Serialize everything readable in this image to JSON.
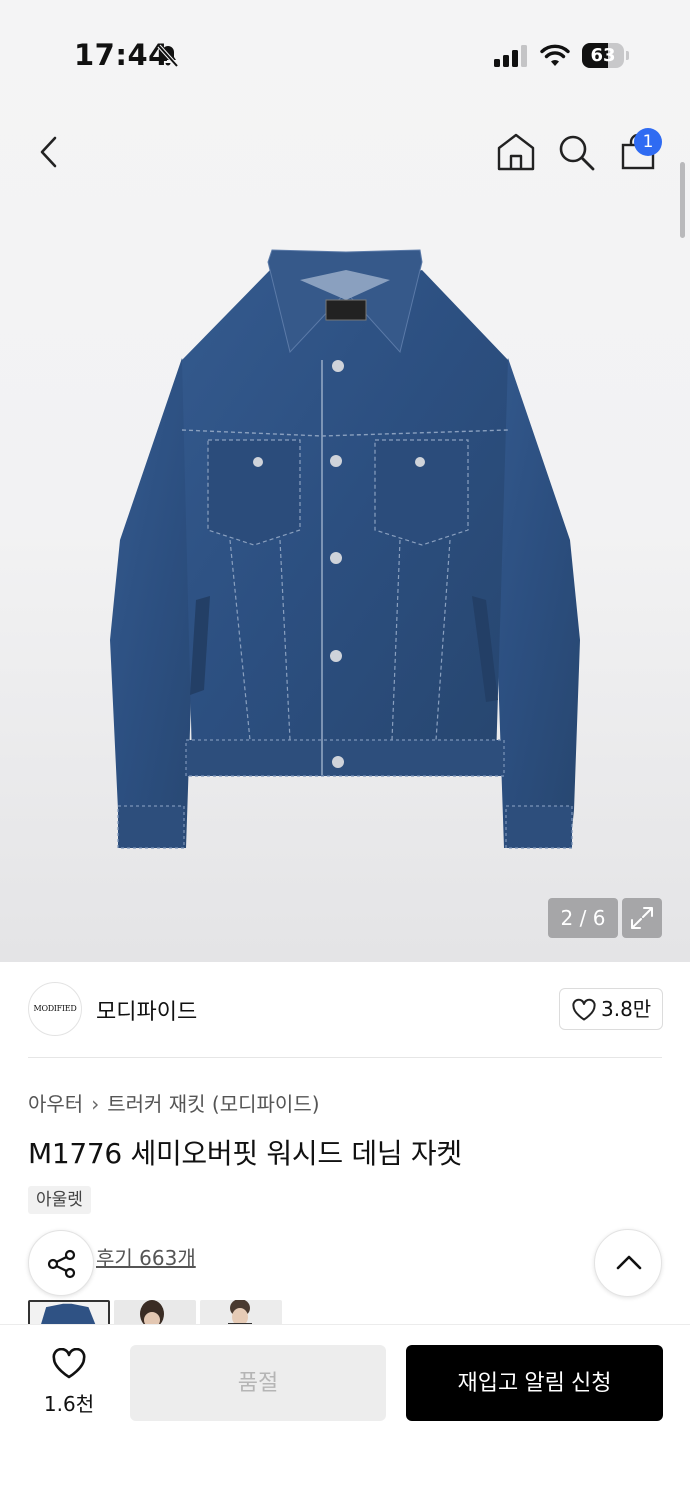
{
  "status_bar": {
    "time": "17:44",
    "battery": "63",
    "battery_level": 0.63,
    "icons": [
      "bell-slash-icon",
      "cellular-signal-icon",
      "wifi-icon",
      "battery-icon"
    ]
  },
  "nav": {
    "cart_badge": "1",
    "icons": [
      "back-chevron-icon",
      "home-icon",
      "search-icon",
      "shopping-bag-icon"
    ]
  },
  "gallery": {
    "counter": "2 / 6",
    "expand_icon": "expand-icon"
  },
  "brand": {
    "logo_text": "MODIFIED",
    "name": "모디파이드",
    "likes": "3.8만"
  },
  "product": {
    "category": "아우터",
    "subcategory": "트러커 재킷 (모디파이드)",
    "title": "M1776 세미오버핏 워시드 데님 자켓",
    "tag": "아울렛",
    "reviews": "후기 663개"
  },
  "bottom_bar": {
    "wish_count": "1.6천",
    "soldout_label": "품절",
    "restock_label": "재입고 알림 신청"
  },
  "colors": {
    "accent_badge": "#2f6bf2",
    "denim": "#2f5284",
    "primary_button": "#000000",
    "disabled_button": "#ededed"
  }
}
